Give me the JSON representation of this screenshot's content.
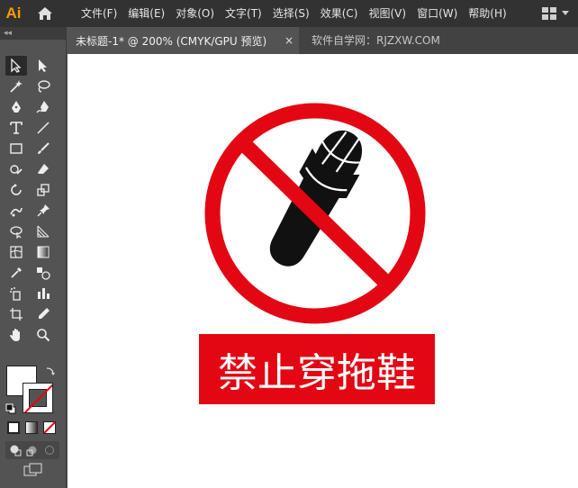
{
  "app": {
    "logo": "Ai"
  },
  "menu": {
    "items": [
      "文件(F)",
      "编辑(E)",
      "对象(O)",
      "文字(T)",
      "选择(S)",
      "效果(C)",
      "视图(V)",
      "窗口(W)",
      "帮助(H)"
    ]
  },
  "tabs": {
    "active_label": "未标题-1* @ 200% (CMYK/GPU 预览)",
    "close": "×",
    "second_label": "软件自学网：RJZXW.COM"
  },
  "toolbar": {
    "collapse": "◂◂"
  },
  "artwork": {
    "sign_text": "禁止穿拖鞋",
    "accent_red": "#e30613",
    "icon": "no-slippers-prohibition-icon"
  }
}
